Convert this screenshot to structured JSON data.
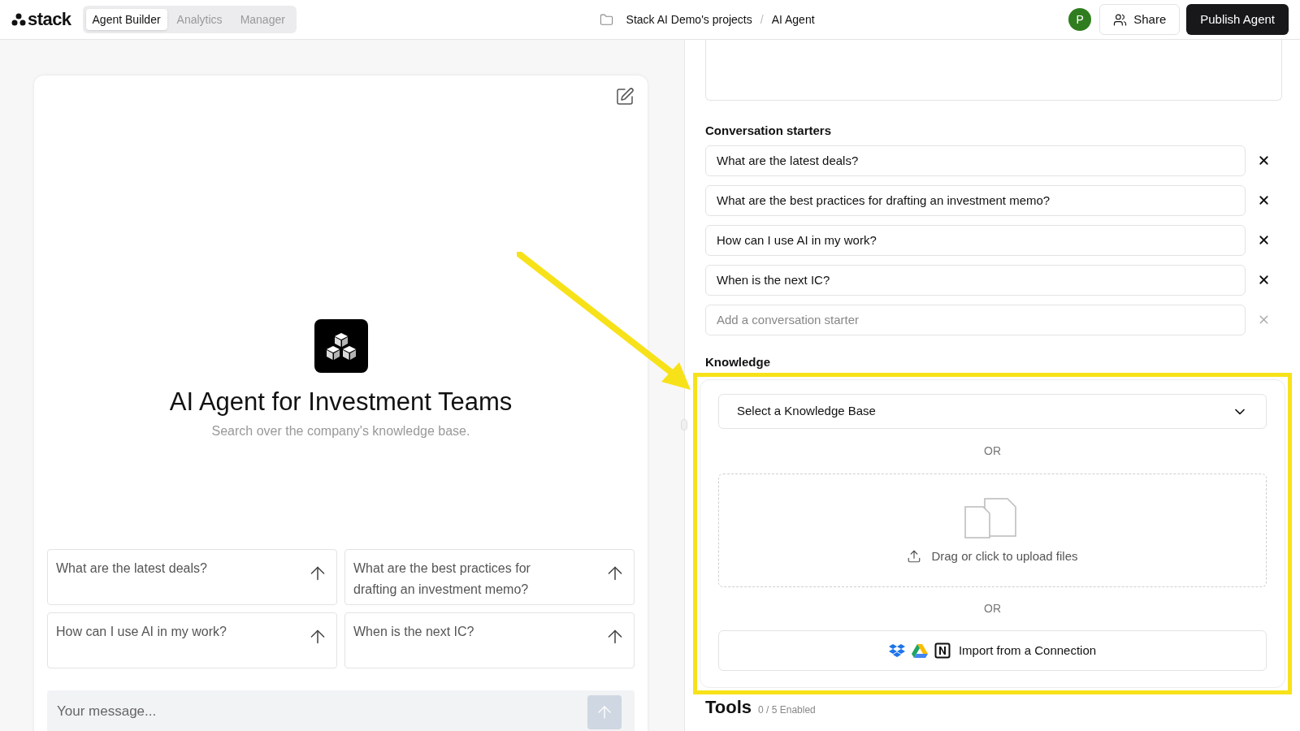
{
  "header": {
    "logo": "stack",
    "tabs": [
      {
        "label": "Agent Builder",
        "selected": true
      },
      {
        "label": "Analytics",
        "selected": false
      },
      {
        "label": "Manager",
        "selected": false
      }
    ],
    "breadcrumb": [
      "Stack AI Demo's projects",
      "/",
      "AI Agent"
    ],
    "avatar": {
      "initial": "P",
      "color": "#2f7d1f"
    },
    "share": "Share",
    "publish": "Publish Agent"
  },
  "preview": {
    "title": "AI Agent for Investment Teams",
    "subtitle": "Search over the company's knowledge base.",
    "suggestions": [
      "What are the latest deals?",
      "What are the best practices for drafting an investment memo?",
      "How can I use AI in my work?",
      "When is the next IC?"
    ],
    "message_placeholder": "Your message..."
  },
  "settings": {
    "starters_label": "Conversation starters",
    "starters": [
      "What are the latest deals?",
      "What are the best practices for drafting an investment memo?",
      "How can I use AI in my work?",
      "When is the next IC?"
    ],
    "starter_placeholder": "Add a conversation starter",
    "knowledge": {
      "label": "Knowledge",
      "select_placeholder": "Select a Knowledge Base",
      "or_1": "OR",
      "upload": "Drag or click to upload files",
      "or_2": "OR",
      "import": "Import from a Connection",
      "highlighted": true
    },
    "tools": {
      "label": "Tools",
      "count": "0 / 5 Enabled"
    }
  }
}
